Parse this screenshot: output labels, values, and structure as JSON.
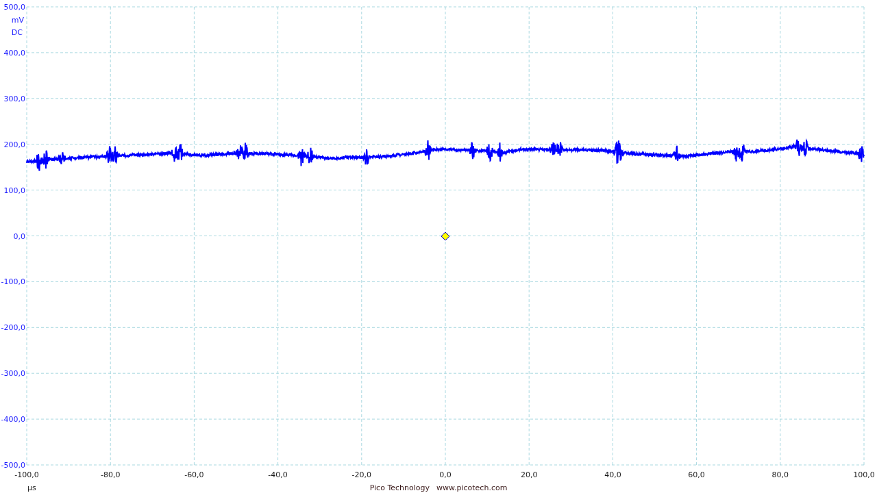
{
  "y_axis": {
    "labels": [
      "500,0",
      "400,0",
      "300,0",
      "200,0",
      "100,0",
      "0,0",
      "-100,0",
      "-200,0",
      "-300,0",
      "-400,0",
      "-500,0"
    ],
    "unit": "mV",
    "coupling": "DC"
  },
  "x_axis": {
    "labels": [
      "-100,0",
      "-80,0",
      "-60,0",
      "-40,0",
      "-20,0",
      "0,0",
      "20,0",
      "40,0",
      "60,0",
      "80,0",
      "100,0"
    ],
    "unit": "µs"
  },
  "footer": {
    "company": "Pico Technology",
    "website": "www.picotech.com"
  }
}
